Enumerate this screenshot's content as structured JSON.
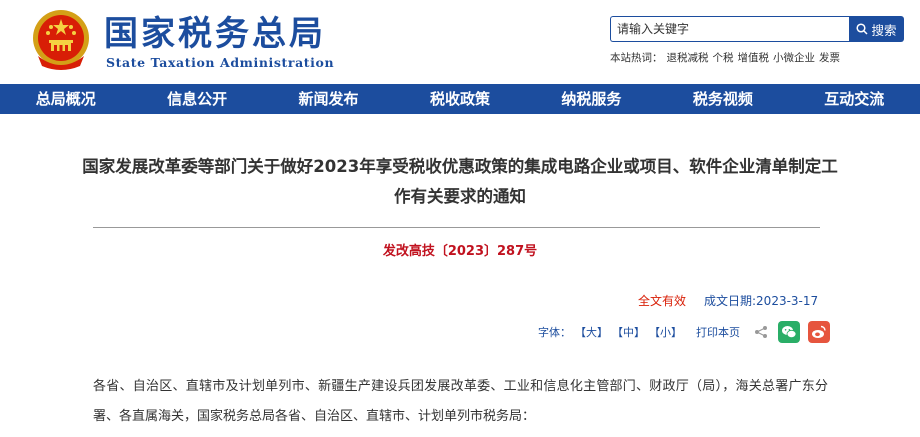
{
  "header": {
    "logo_cn": "国家税务总局",
    "logo_en": "State Taxation Administration",
    "search_placeholder": "请输入关键字",
    "search_button": "搜索",
    "hot_label": "本站热词：",
    "hot_words": [
      "退税减税",
      "个税",
      "增值税",
      "小微企业",
      "发票"
    ]
  },
  "nav": {
    "items": [
      "总局概况",
      "信息公开",
      "新闻发布",
      "税收政策",
      "纳税服务",
      "税务视频",
      "互动交流"
    ]
  },
  "article": {
    "title": "国家发展改革委等部门关于做好2023年享受税收优惠政策的集成电路企业或项目、软件企业清单制定工作有关要求的通知",
    "doc_number": "发改高技〔2023〕287号",
    "validity": "全文有效",
    "date_label": "成文日期:",
    "date": "2023-3-17",
    "font_label": "字体：",
    "font_large": "【大】",
    "font_medium": "【中】",
    "font_small": "【小】",
    "print": "打印本页",
    "body": "各省、自治区、直辖市及计划单列市、新疆生产建设兵团发展改革委、工业和信息化主管部门、财政厅（局），海关总署广东分署、各直属海关，国家税务总局各省、自治区、直辖市、计划单列市税务局："
  },
  "colors": {
    "brand_blue": "#1c4d9e",
    "doc_red": "#c1121f",
    "validity_red": "#d81e06"
  }
}
